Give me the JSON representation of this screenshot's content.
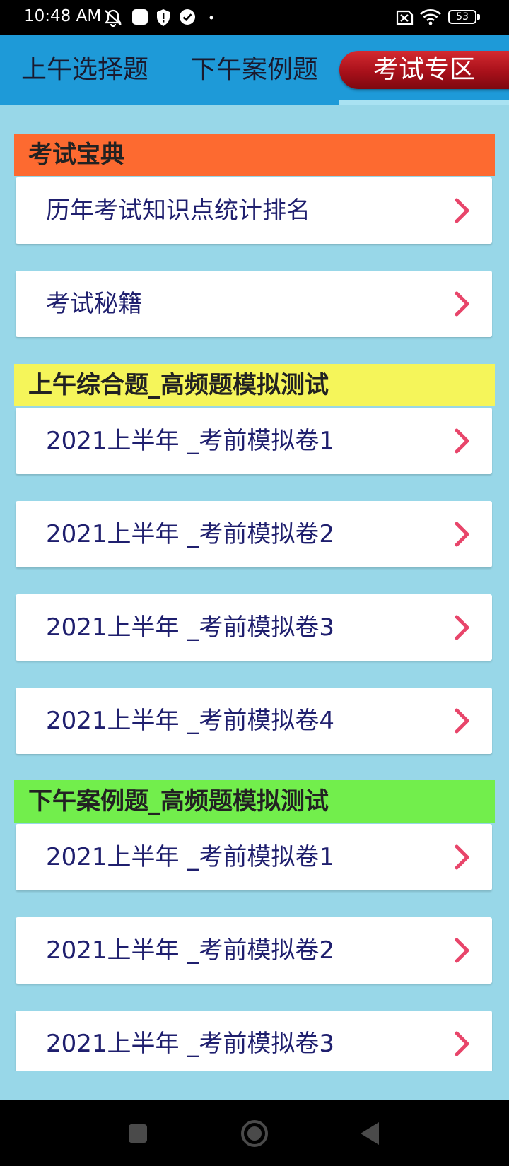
{
  "status_bar": {
    "time": "10:48 AM",
    "battery": "53",
    "icons": [
      "notifications-off-icon",
      "app-square-icon",
      "shield-icon",
      "check-circle-icon",
      "dot-icon",
      "sim-x-icon",
      "wifi-icon",
      "battery-icon"
    ]
  },
  "tabs": [
    {
      "label": "上午选择题",
      "active": false
    },
    {
      "label": "下午案例题",
      "active": false
    },
    {
      "label": "考试专区",
      "active": true
    }
  ],
  "sections": [
    {
      "header": "考试宝典",
      "color": "#fd6a30",
      "items": [
        "历年考试知识点统计排名",
        "考试秘籍"
      ]
    },
    {
      "header": "上午综合题_高频题模拟测试",
      "color": "#f5f55a",
      "items": [
        "2021上半年 _考前模拟卷1",
        "2021上半年 _考前模拟卷2",
        "2021上半年 _考前模拟卷3",
        "2021上半年 _考前模拟卷4"
      ]
    },
    {
      "header": "下午案例题_高频题模拟测试",
      "color": "#72ee4c",
      "items": [
        "2021上半年 _考前模拟卷1",
        "2021上半年 _考前模拟卷2",
        "2021上半年 _考前模拟卷3"
      ]
    }
  ],
  "colors": {
    "background": "#98d7e8",
    "tab_bar": "#1e9ad8",
    "active_tab": "#b01820",
    "chevron": "#e8456a",
    "item_text": "#1f1f6e"
  },
  "nav_bar": {
    "icons": [
      "recents-square-icon",
      "home-circle-icon",
      "back-triangle-icon"
    ]
  }
}
